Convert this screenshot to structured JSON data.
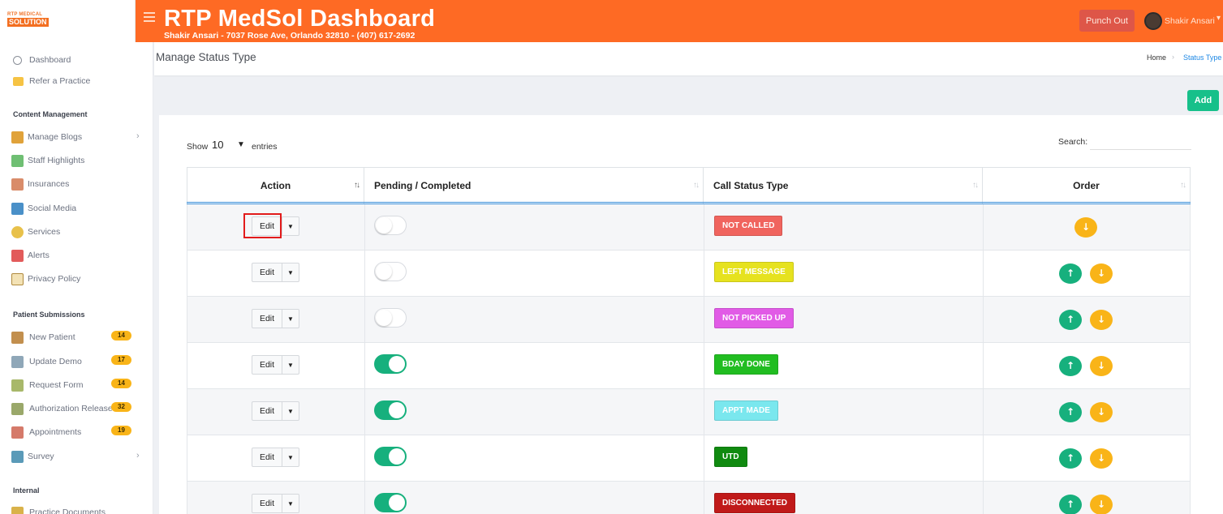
{
  "header": {
    "logo_line1": "RTP MEDICAL",
    "logo_line2": "SOLUTION",
    "title": "RTP MedSol Dashboard",
    "subtitle": "Shakir Ansari - 7037 Rose Ave, Orlando 32810 - (407) 617-2692",
    "punch_out": "Punch Out",
    "user_name": "Shakir Ansari"
  },
  "sidebar": {
    "top_items": [
      {
        "label": "Dashboard",
        "icon": "gauge-icon"
      },
      {
        "label": "Refer a Practice",
        "icon": "envelope-icon"
      }
    ],
    "sections": [
      {
        "heading": "Content Management",
        "items": [
          {
            "label": "Manage Blogs",
            "icon": "blog-icon",
            "has_submenu": true
          },
          {
            "label": "Staff Highlights",
            "icon": "staff-icon"
          },
          {
            "label": "Insurances",
            "icon": "insurance-icon"
          },
          {
            "label": "Social Media",
            "icon": "social-icon"
          },
          {
            "label": "Services",
            "icon": "services-icon"
          },
          {
            "label": "Alerts",
            "icon": "alert-icon"
          },
          {
            "label": "Privacy Policy",
            "icon": "lock-icon"
          }
        ]
      },
      {
        "heading": "Patient Submissions",
        "items": [
          {
            "label": "New Patient",
            "icon": "clipboard-icon",
            "badge": "14"
          },
          {
            "label": "Update Demo",
            "icon": "id-card-icon",
            "badge": "17"
          },
          {
            "label": "Request Form",
            "icon": "form-icon",
            "badge": "14"
          },
          {
            "label": "Authorization Release",
            "icon": "release-icon",
            "badge": "32"
          },
          {
            "label": "Appointments",
            "icon": "calendar-icon",
            "badge": "19"
          },
          {
            "label": "Survey",
            "icon": "survey-icon",
            "has_submenu": true
          }
        ]
      },
      {
        "heading": "Internal",
        "items": [
          {
            "label": "Practice Documents",
            "icon": "document-icon"
          }
        ]
      }
    ]
  },
  "page": {
    "title": "Manage Status Type",
    "breadcrumb_home": "Home",
    "breadcrumb_current": "Status Type",
    "add_label": "Add"
  },
  "table_controls": {
    "show_label": "Show",
    "page_size": "10",
    "entries_label": "entries",
    "search_label": "Search:",
    "search_value": ""
  },
  "table": {
    "columns": [
      "Action",
      "Pending / Completed",
      "Call Status Type",
      "Order"
    ],
    "edit_label": "Edit",
    "rows": [
      {
        "completed": false,
        "status": "NOT CALLED",
        "bg": "#f0645e",
        "fg": "#ffffff",
        "has_up": false,
        "has_down": true,
        "highlighted": true
      },
      {
        "completed": false,
        "status": "LEFT MESSAGE",
        "bg": "#e6e21f",
        "fg": "#ffffff",
        "has_up": true,
        "has_down": true
      },
      {
        "completed": false,
        "status": "NOT PICKED UP",
        "bg": "#e15be6",
        "fg": "#ffffff",
        "has_up": true,
        "has_down": true
      },
      {
        "completed": true,
        "status": "BDAY DONE",
        "bg": "#21bd21",
        "fg": "#ffffff",
        "has_up": true,
        "has_down": true
      },
      {
        "completed": true,
        "status": "APPT MADE",
        "bg": "#7ae7ee",
        "fg": "#ffffff",
        "has_up": true,
        "has_down": true
      },
      {
        "completed": true,
        "status": "UTD",
        "bg": "#108a10",
        "fg": "#ffffff",
        "has_up": true,
        "has_down": true
      },
      {
        "completed": true,
        "status": "DISCONNECTED",
        "bg": "#c01a1a",
        "fg": "#ffffff",
        "has_up": true,
        "has_down": true
      }
    ]
  },
  "colors": {
    "header_bg": "#fe6a24",
    "accent_green": "#17b07d",
    "accent_yellow": "#f9b418",
    "highlight_red": "#e21b1b"
  }
}
